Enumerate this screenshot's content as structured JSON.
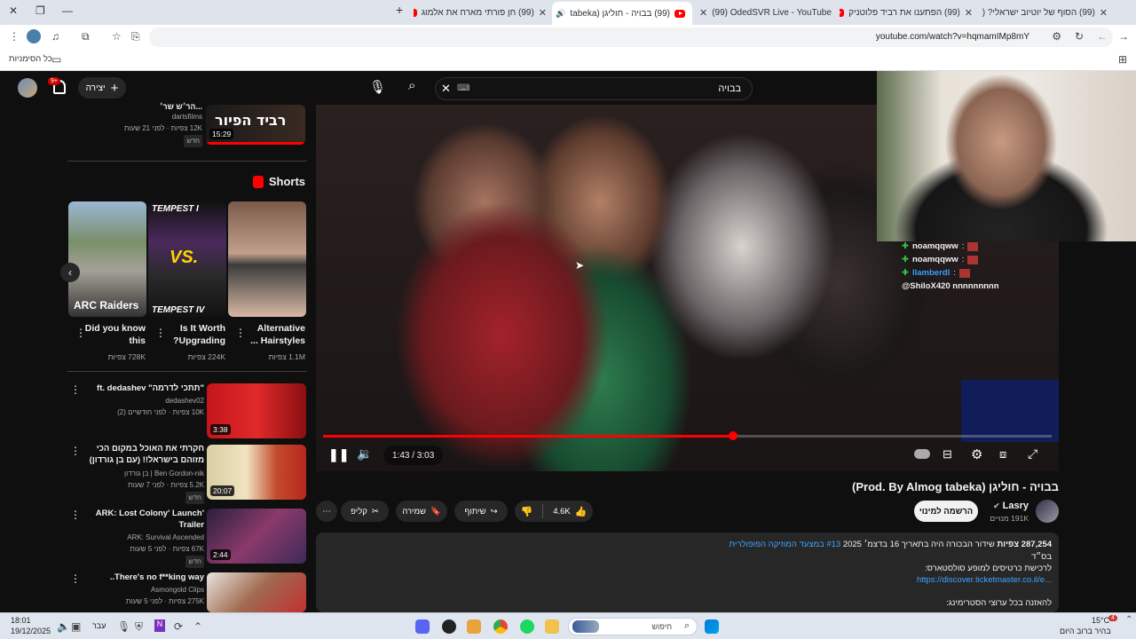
{
  "browser": {
    "tabs": [
      {
        "title": "(99) הסוף של יוטיוב ישראלי? (נ..."
      },
      {
        "title": "(99) הפתענו את רביד פלוטניק"
      },
      {
        "title": "(99) OdedSVR Live - YouTube"
      },
      {
        "title": "(99) בבויה - חוליגן (tabeka"
      },
      {
        "title": "(99) חן פורתי מארח את אלמוג"
      }
    ],
    "url": "youtube.com/watch?v=hqmamIMp8mY",
    "bookmarks_label": "כל הסימניות"
  },
  "header": {
    "search_query": "בבויה",
    "create_label": "יצירה",
    "notif_count": "9+"
  },
  "player": {
    "current_time": "1:43",
    "total_time": "3:03",
    "time_display": "1:43 / 3:03",
    "progress": 0.5628
  },
  "chat": {
    "lines": [
      {
        "user": "noamqqww",
        "msg": ":"
      },
      {
        "user": "noamqqww",
        "msg": ":"
      },
      {
        "user": "llamberdl",
        "msg": ":"
      },
      {
        "user": "",
        "msg": "@ShiloX420 nnnnnnnnn"
      }
    ]
  },
  "video": {
    "title": "בבויה - חוליגן (Prod. By Almog tabeka)",
    "channel": "Lasry",
    "subscribers": "191K מנויים",
    "subscribe_label": "הרשמה למינוי",
    "likes": "4.6K",
    "share_label": "שיתוף",
    "save_label": "שמירה",
    "clip_label": "קליפ",
    "views": "287,254 צפיות",
    "desc_line1": "שידור הבכורה היה בתאריך 16 בדצמ׳ 2025",
    "desc_tag": "#13 במצעד המוזיקה הפופולרית",
    "desc_line2": "בס״ד",
    "desc_line3": "לרכישת כרטיסים למופע סולסטארס:",
    "desc_link": "https://discover.ticketmaster.co.il/e...",
    "desc_line4": "להאזנה בכל ערוצי הסטרימינג:"
  },
  "related_top": {
    "title": "...הר׳ש שר׳",
    "channel": "dartsfilms",
    "meta": "12K צפיות · לפני 21 שעות",
    "badge": "חדש",
    "duration": "15:29",
    "thumb_text": "רביד הפיור"
  },
  "shorts": {
    "heading": "Shorts",
    "items": [
      {
        "title": "Alternative Hairstyles ...",
        "views": "1.1M צפיות"
      },
      {
        "title": "Is It Worth Upgrading?",
        "views": "224K צפיות"
      },
      {
        "title": "Did you know this",
        "views": "728K צפיות"
      }
    ],
    "thumb2_top": "TEMPEST I",
    "thumb2_bottom": "TEMPEST IV",
    "thumb2_vs": "VS.",
    "thumb3_text": "ARC Raiders"
  },
  "related": [
    {
      "title": "\"תתכי לדרמה\" ft. dedashev",
      "channel": "dedashev02",
      "meta": "10K צפיות · לפני חודשיים (2)",
      "badge": "",
      "duration": "3:38"
    },
    {
      "title": "חקרתי את האוכל במקום הכי מזוהם בישראל!! (עם בן גורדון)",
      "channel": "Ben Gordon-nik | בן גורדון",
      "meta": "5.2K צפיות · לפני 7 שעות",
      "badge": "חדש",
      "duration": "20:07"
    },
    {
      "title": "'ARK: Lost Colony' Launch Trailer",
      "channel": "ARK: Survival Ascended",
      "meta": "67K צפיות · לפני 5 שעות",
      "badge": "חדש",
      "duration": "2:44"
    },
    {
      "title": "There's no f**king way..",
      "channel": "Asmongold Clips",
      "meta": "275K צפיות · לפני 5 שעות",
      "badge": "",
      "duration": ""
    }
  ],
  "taskbar": {
    "time": "18:01",
    "date": "19/12/2025",
    "lang": "עבר",
    "search_label": "חיפוש",
    "weather_temp": "15°C",
    "weather_desc": "בהיר ברוב היום",
    "notif": "4"
  }
}
